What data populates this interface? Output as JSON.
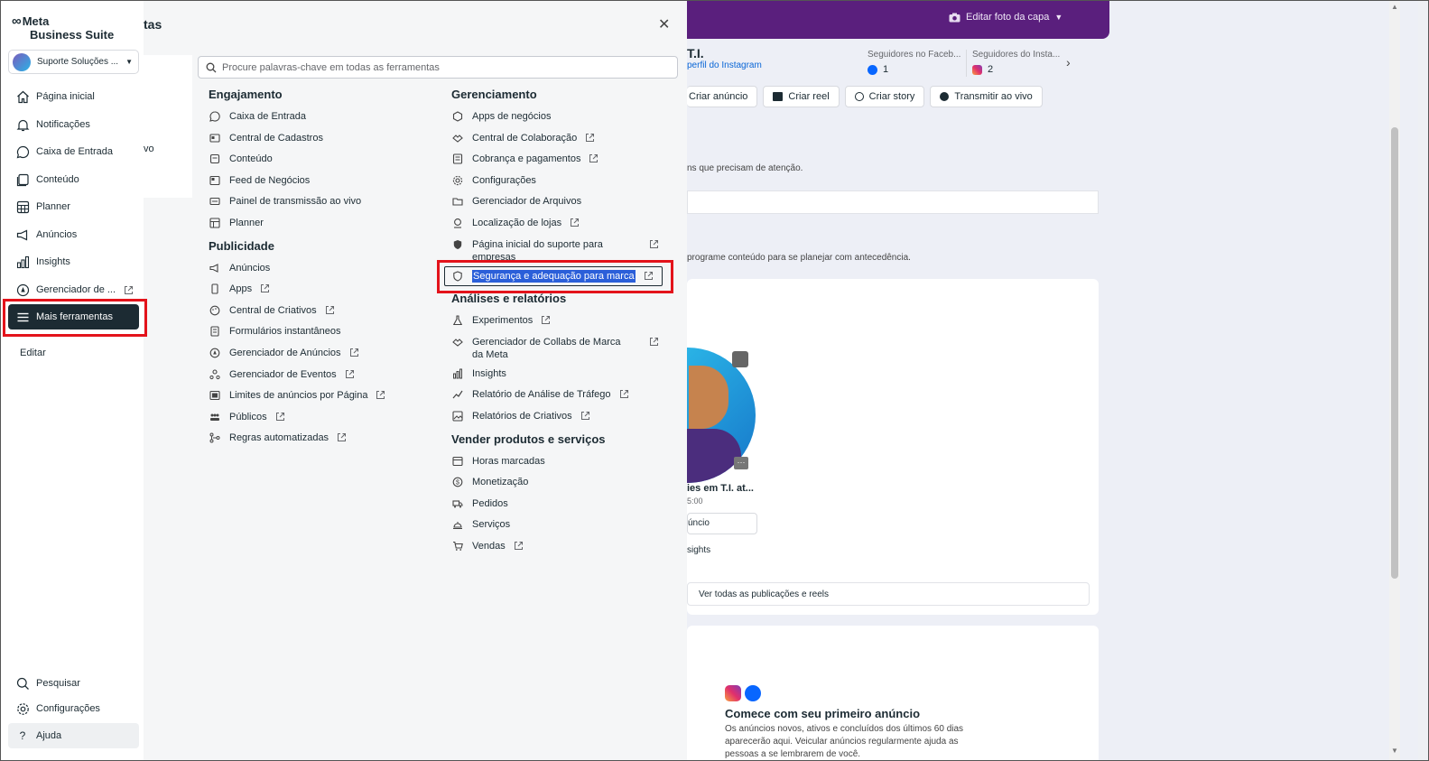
{
  "nav": {
    "logo_line1": "Meta",
    "logo_line2": "Business Suite",
    "account": "Suporte Soluções ...",
    "items": [
      {
        "label": "Página inicial",
        "icon": "home-icon"
      },
      {
        "label": "Notificações",
        "icon": "bell-icon"
      },
      {
        "label": "Caixa de Entrada",
        "icon": "chat-bubble-icon"
      },
      {
        "label": "Conteúdo",
        "icon": "content-icon"
      },
      {
        "label": "Planner",
        "icon": "calendar-grid-icon"
      },
      {
        "label": "Anúncios",
        "icon": "megaphone-icon"
      },
      {
        "label": "Insights",
        "icon": "bar-chart-icon"
      },
      {
        "label": "Gerenciador de ...",
        "icon": "ads-manager-icon"
      },
      {
        "label": "Mais ferramentas",
        "icon": "menu-icon"
      }
    ],
    "edit": "Editar",
    "bottom": [
      {
        "label": "Pesquisar",
        "icon": "search-icon"
      },
      {
        "label": "Configurações",
        "icon": "gear-icon"
      },
      {
        "label": "Ajuda",
        "icon": "help-icon"
      }
    ]
  },
  "popup": {
    "title": "tas",
    "left_fragment": "vo",
    "search_placeholder": "Procure palavras-chave em todas as ferramentas",
    "engajamento": {
      "title": "Engajamento",
      "items": [
        "Caixa de Entrada",
        "Central de Cadastros",
        "Conteúdo",
        "Feed de Negócios",
        "Painel de transmissão ao vivo",
        "Planner"
      ]
    },
    "publicidade": {
      "title": "Publicidade",
      "items": [
        "Anúncios",
        "Apps",
        "Central de Criativos",
        "Formulários instantâneos",
        "Gerenciador de Anúncios",
        "Gerenciador de Eventos",
        "Limites de anúncios por Página",
        "Públicos",
        "Regras automatizadas"
      ]
    },
    "gerenciamento": {
      "title": "Gerenciamento",
      "items": [
        "Apps de negócios",
        "Central de Colaboração",
        "Cobrança e pagamentos",
        "Configurações",
        "Gerenciador de Arquivos",
        "Localização de lojas",
        "Página inicial do suporte para empresas",
        "Segurança e adequação para marca"
      ]
    },
    "analises": {
      "title": "Análises e relatórios",
      "items": [
        "Experimentos",
        "Gerenciador de Collabs de Marca da Meta",
        "Insights",
        "Relatório de Análise de Tráfego",
        "Relatórios de Criativos"
      ]
    },
    "vender": {
      "title": "Vender produtos e serviços",
      "items": [
        "Horas marcadas",
        "Monetização",
        "Pedidos",
        "Serviços",
        "Vendas"
      ]
    }
  },
  "background": {
    "cover_button": "Editar foto da capa",
    "page_name": "T.I.",
    "ig_link": "perfil do Instagram",
    "fb_followers_label": "Seguidores no Faceb...",
    "fb_followers": "1",
    "ig_followers_label": "Seguidores do Insta...",
    "ig_followers": "2",
    "actions": [
      "Criar anúncio",
      "Criar reel",
      "Criar story",
      "Transmitir ao vivo"
    ],
    "note1": "ns que precisam de atenção.",
    "note2": "programe conteúdo para se planejar com antecedência.",
    "post_title": "ies em T.I. at...",
    "post_time": "5:00",
    "post_button": "úncio",
    "post_insights": "sights",
    "see_all": "Ver todas as publicações e reels",
    "panel2_title": "Comece com seu primeiro anúncio",
    "panel2_text": "Os anúncios novos, ativos e concluídos dos últimos 60 dias aparecerão aqui. Veicular anúncios regularmente ajuda as pessoas a se lembrarem de você."
  },
  "colors": {
    "highlight_red": "#e3131b",
    "active_nav": "#1c2b33",
    "selection_blue": "#2b5fd9",
    "cover_purple": "#5a1f7d"
  }
}
